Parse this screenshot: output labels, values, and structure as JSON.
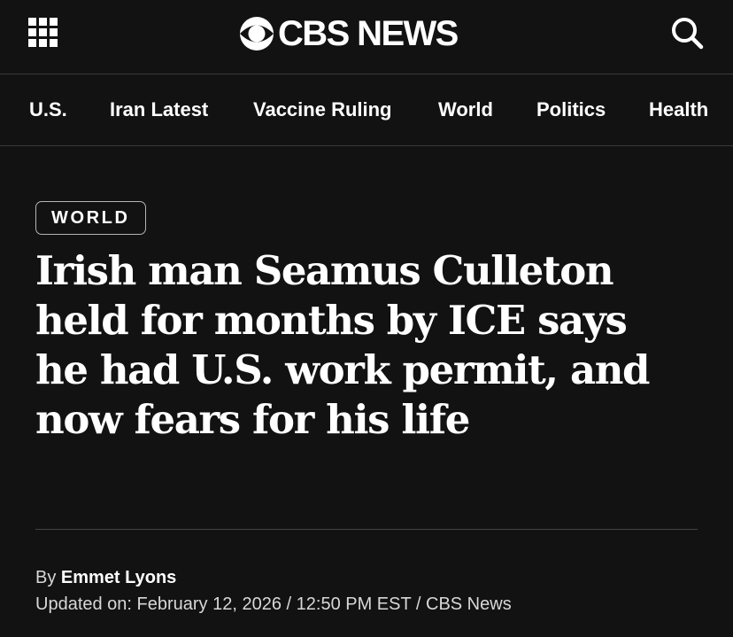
{
  "header": {
    "logo_text": "CBS NEWS",
    "menu_icon": "grid-menu-icon",
    "search_icon": "search-icon",
    "logo_icon": "cbs-eye-icon"
  },
  "nav": {
    "items": [
      {
        "label": "U.S."
      },
      {
        "label": "Iran Latest"
      },
      {
        "label": "Vaccine Ruling"
      },
      {
        "label": "World"
      },
      {
        "label": "Politics"
      },
      {
        "label": "Health"
      }
    ]
  },
  "article": {
    "section": "WORLD",
    "headline": "Irish man Seamus Culleton held for months by ICE says he had U.S. work permit, and now fears for his life",
    "byline_prefix": "By ",
    "author": "Emmet Lyons",
    "updated": "Updated on: February 12, 2026 / 12:50 PM EST / CBS News"
  },
  "colors": {
    "background": "#121212",
    "text": "#ffffff",
    "muted_text": "#d8d8d8",
    "divider": "#3a3a3a"
  }
}
